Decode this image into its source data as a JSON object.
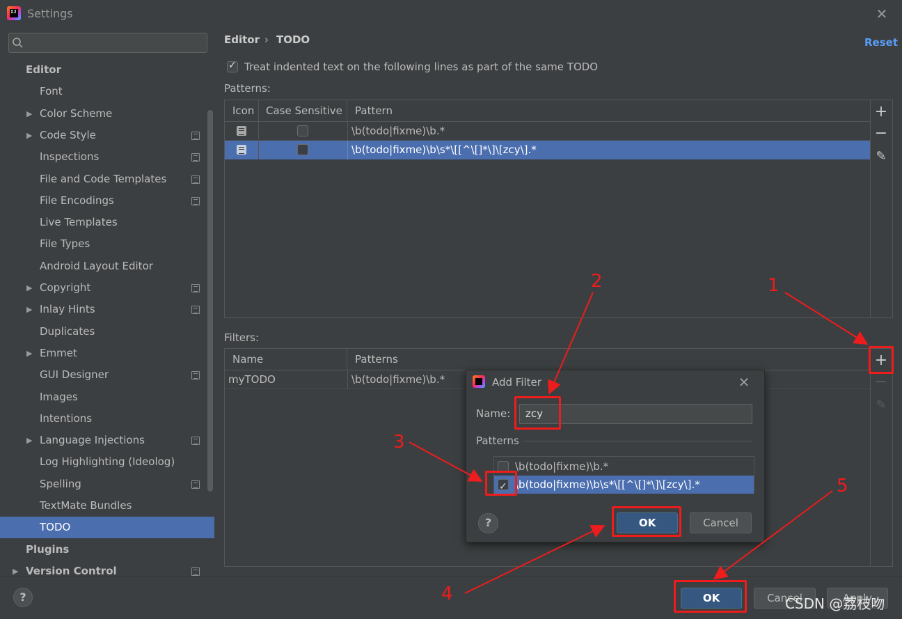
{
  "window": {
    "title": "Settings",
    "close": "✕"
  },
  "sidebar": {
    "search_placeholder": "",
    "items": [
      {
        "label": "Editor",
        "level": 1
      },
      {
        "label": "Font",
        "level": 2
      },
      {
        "label": "Color Scheme",
        "level": 2,
        "expandable": true
      },
      {
        "label": "Code Style",
        "level": 2,
        "expandable": true,
        "config": true
      },
      {
        "label": "Inspections",
        "level": 2,
        "config": true
      },
      {
        "label": "File and Code Templates",
        "level": 2,
        "config": true
      },
      {
        "label": "File Encodings",
        "level": 2,
        "config": true
      },
      {
        "label": "Live Templates",
        "level": 2
      },
      {
        "label": "File Types",
        "level": 2
      },
      {
        "label": "Android Layout Editor",
        "level": 2
      },
      {
        "label": "Copyright",
        "level": 2,
        "expandable": true,
        "config": true
      },
      {
        "label": "Inlay Hints",
        "level": 2,
        "expandable": true,
        "config": true
      },
      {
        "label": "Duplicates",
        "level": 2
      },
      {
        "label": "Emmet",
        "level": 2,
        "expandable": true
      },
      {
        "label": "GUI Designer",
        "level": 2,
        "config": true
      },
      {
        "label": "Images",
        "level": 2
      },
      {
        "label": "Intentions",
        "level": 2
      },
      {
        "label": "Language Injections",
        "level": 2,
        "expandable": true,
        "config": true
      },
      {
        "label": "Log Highlighting (Ideolog)",
        "level": 2
      },
      {
        "label": "Spelling",
        "level": 2,
        "config": true
      },
      {
        "label": "TextMate Bundles",
        "level": 2
      },
      {
        "label": "TODO",
        "level": 2,
        "selected": true
      },
      {
        "label": "Plugins",
        "level": 1
      },
      {
        "label": "Version Control",
        "level": 1,
        "expandable": true,
        "config": true
      }
    ]
  },
  "breadcrumb": {
    "parent": "Editor",
    "separator": "›",
    "current": "TODO"
  },
  "reset_label": "Reset",
  "treat_indented": {
    "label": "Treat indented text on the following lines as part of the same TODO",
    "checked": true
  },
  "patterns": {
    "label": "Patterns:",
    "columns": [
      "Icon",
      "Case Sensitive",
      "Pattern"
    ],
    "rows": [
      {
        "case_sensitive": false,
        "pattern": "\\b(todo|fixme)\\b.*",
        "selected": false
      },
      {
        "case_sensitive": false,
        "pattern": "\\b(todo|fixme)\\b\\s*\\[[^\\[]*\\]\\[zcy\\].*",
        "selected": true
      }
    ]
  },
  "filters": {
    "label": "Filters:",
    "columns": [
      "Name",
      "Patterns"
    ],
    "rows": [
      {
        "name": "myTODO",
        "patterns": "\\b(todo|fixme)\\b.*"
      }
    ]
  },
  "side_buttons": {
    "add": "+",
    "remove": "−",
    "edit": "✎"
  },
  "dialog": {
    "title": "Add Filter",
    "close": "✕",
    "name_label": "Name:",
    "name_value": "zcy",
    "patterns_label": "Patterns",
    "patterns": [
      {
        "pattern": "\\b(todo|fixme)\\b.*",
        "checked": false
      },
      {
        "pattern": "\\b(todo|fixme)\\b\\s*\\[[^\\[]*\\]\\[zcy\\].*",
        "checked": true,
        "selected": true
      }
    ],
    "help": "?",
    "ok": "OK",
    "cancel": "Cancel"
  },
  "footer": {
    "help": "?",
    "ok": "OK",
    "cancel": "Cancel",
    "apply": "Apply"
  },
  "annotations": {
    "labels": [
      "1",
      "2",
      "3",
      "4",
      "5"
    ],
    "color": "#ee1c1c"
  },
  "watermark": "CSDN @荔枝吻"
}
